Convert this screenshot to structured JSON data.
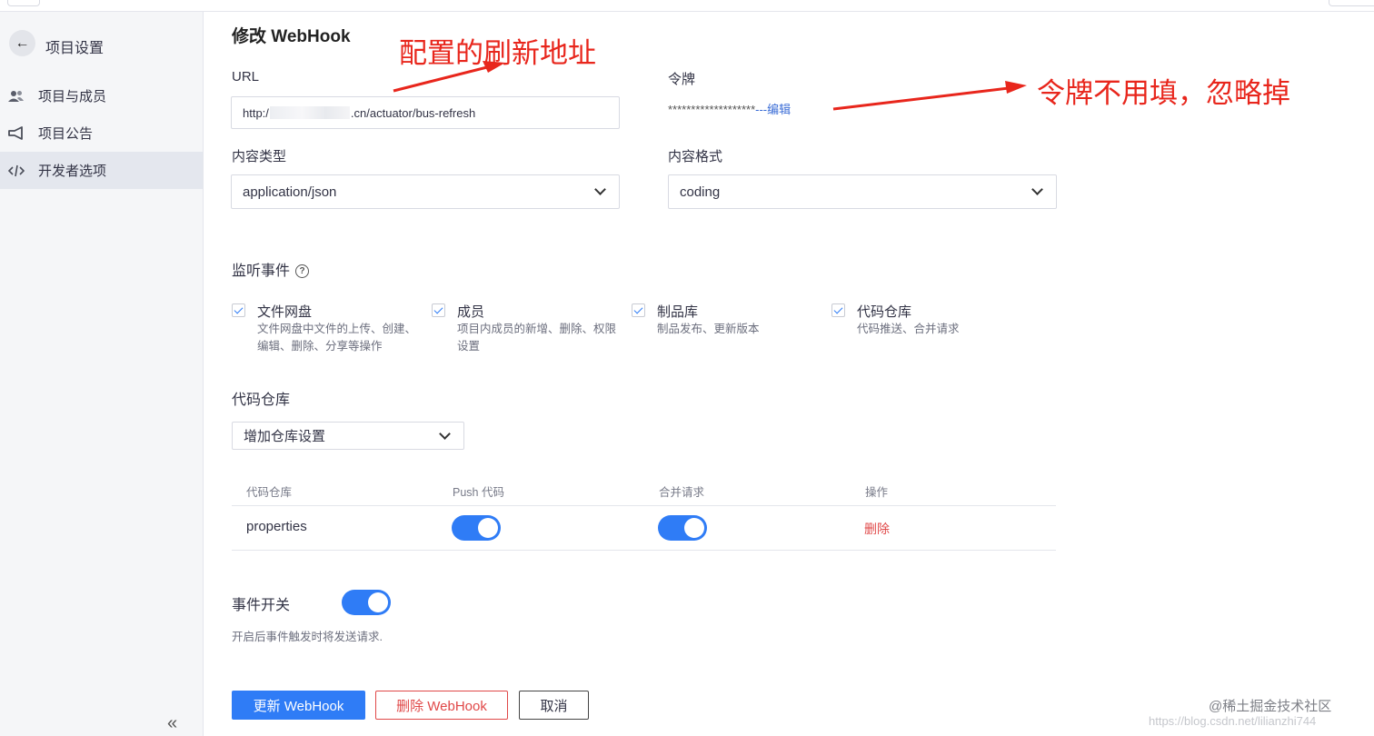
{
  "sidebar": {
    "back_label": "项目设置",
    "items": [
      {
        "label": "项目与成员",
        "icon": "members-icon"
      },
      {
        "label": "项目公告",
        "icon": "megaphone-icon"
      },
      {
        "label": "开发者选项",
        "icon": "code-icon",
        "active": true
      }
    ]
  },
  "page": {
    "title": "修改 WebHook"
  },
  "form": {
    "url_label": "URL",
    "url_prefix": "http:/",
    "url_suffix": ".cn/actuator/bus-refresh",
    "token_label": "令牌",
    "token_masked": "*******************",
    "token_edit": "---编辑",
    "content_type_label": "内容类型",
    "content_type_value": "application/json",
    "content_format_label": "内容格式",
    "content_format_value": "coding"
  },
  "events": {
    "label": "监听事件",
    "items": [
      {
        "title": "文件网盘",
        "desc": "文件网盘中文件的上传、创建、编辑、删除、分享等操作",
        "checked": true
      },
      {
        "title": "成员",
        "desc": "项目内成员的新增、删除、权限设置",
        "checked": true
      },
      {
        "title": "制品库",
        "desc": "制品发布、更新版本",
        "checked": true
      },
      {
        "title": "代码仓库",
        "desc": "代码推送、合并请求",
        "checked": true
      }
    ]
  },
  "repo": {
    "label": "代码仓库",
    "add_select": "增加仓库设置",
    "columns": [
      "代码仓库",
      "Push 代码",
      "合并请求",
      "操作"
    ],
    "rows": [
      {
        "name": "properties",
        "push": true,
        "merge": true,
        "action": "删除"
      }
    ]
  },
  "event_switch": {
    "label": "事件开关",
    "enabled": true,
    "hint": "开启后事件触发时将发送请求."
  },
  "buttons": {
    "update": "更新 WebHook",
    "delete": "删除 WebHook",
    "cancel": "取消"
  },
  "annotations": {
    "url_note": "配置的刷新地址",
    "token_note": "令牌不用填，忽略掉",
    "color": "#e8261c"
  },
  "watermark": {
    "main": "@稀土掘金技术社区",
    "url": "https://blog.csdn.net/lilianzhi744"
  },
  "colors": {
    "primary": "#2f7cf6",
    "danger": "#e04848"
  }
}
